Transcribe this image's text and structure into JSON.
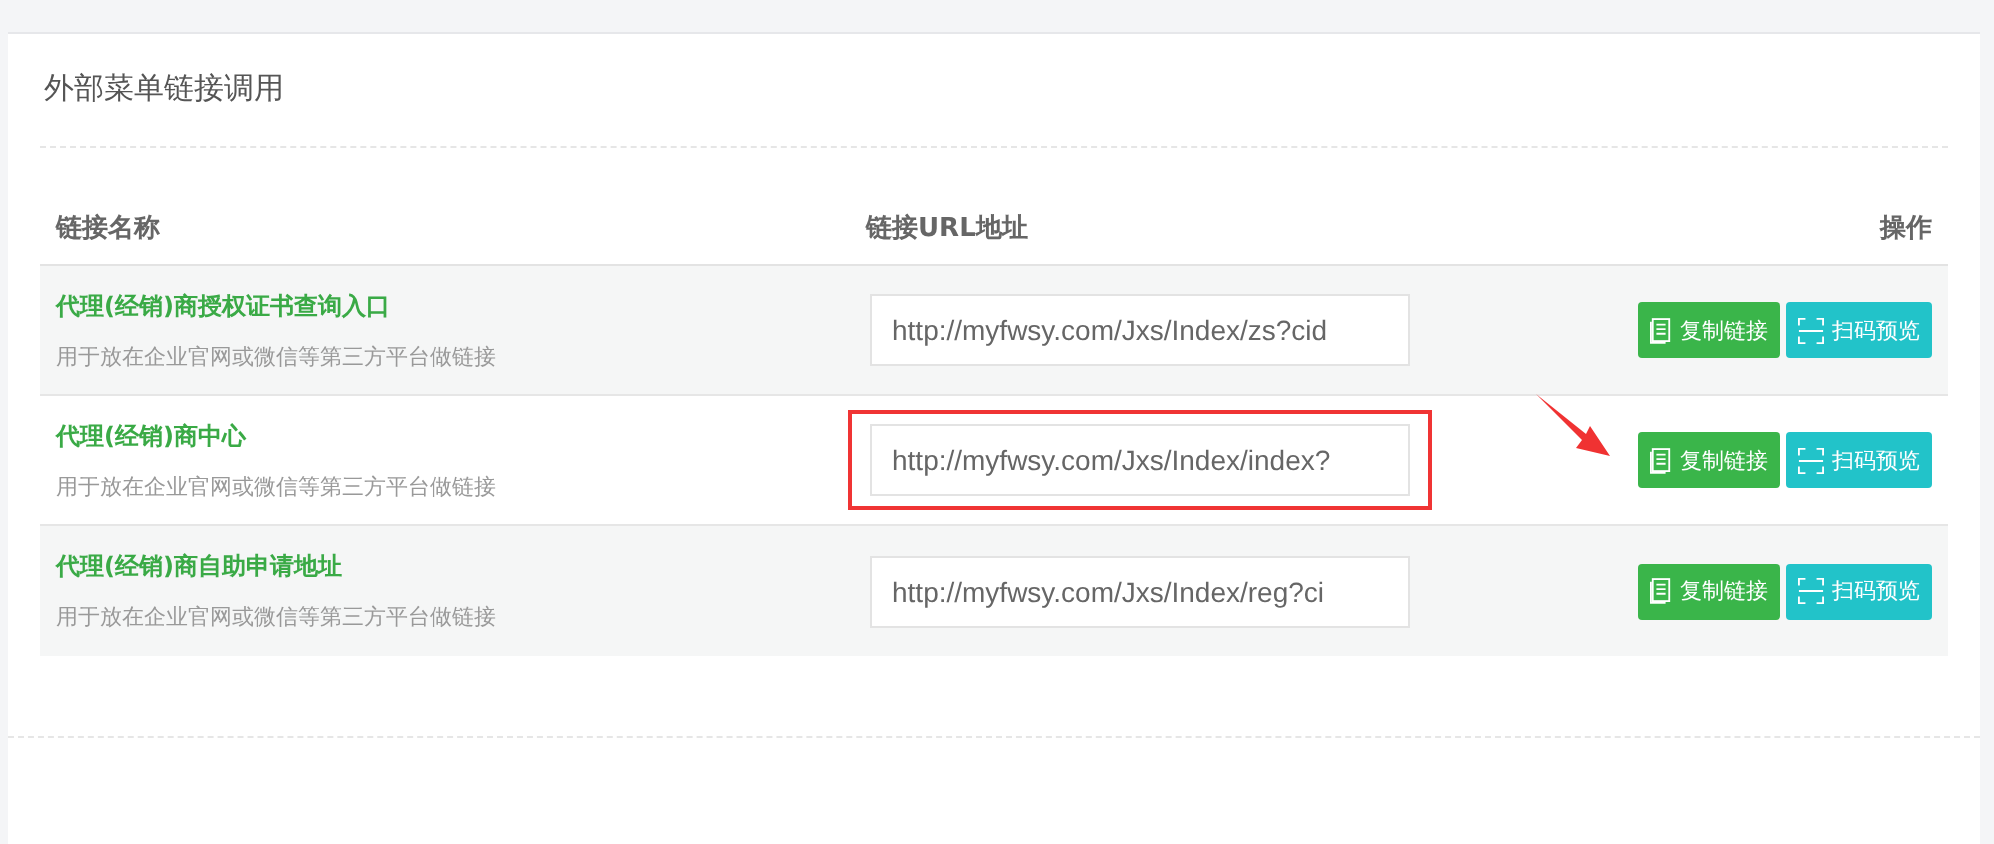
{
  "panel": {
    "title": "外部菜单链接调用"
  },
  "table": {
    "columns": [
      "链接名称",
      "链接URL地址",
      "操作"
    ],
    "rows": [
      {
        "name": "代理(经销)商授权证书查询入口",
        "note": "用于放在企业官网或微信等第三方平台做链接",
        "url": "http://myfwsy.com/Jxs/Index/zs?cid",
        "highlighted": false,
        "actions": [
          "复制链接",
          "扫码预览"
        ]
      },
      {
        "name": "代理(经销)商中心",
        "note": "用于放在企业官网或微信等第三方平台做链接",
        "url": "http://myfwsy.com/Jxs/Index/index?",
        "highlighted": true,
        "actions": [
          "复制链接",
          "扫码预览"
        ]
      },
      {
        "name": "代理(经销)商自助申请地址",
        "note": "用于放在企业官网或微信等第三方平台做链接",
        "url": "http://myfwsy.com/Jxs/Index/reg?ci",
        "highlighted": false,
        "actions": [
          "复制链接",
          "扫码预览"
        ]
      }
    ]
  }
}
